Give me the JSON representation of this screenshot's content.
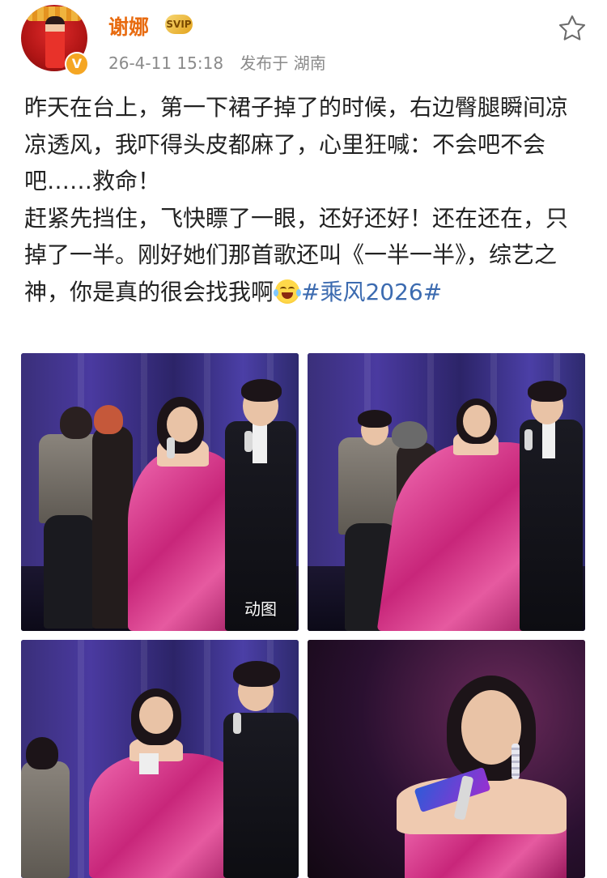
{
  "user": {
    "name": "谢娜",
    "vip_badge": "SVIP",
    "verified_icon": "verified-v-icon"
  },
  "meta": {
    "timestamp": "26-4-11 15:18",
    "location": "发布于 湖南"
  },
  "post": {
    "paragraph_1": "昨天在台上，第一下裙子掉了的时候，右边臀腿瞬间凉凉透风，我吓得头皮都麻了，心里狂喊：不会吧不会吧……救命！",
    "paragraph_2_text": "赶紧先挡住，飞快瞟了一眼，还好还好！还在还在，只掉了一半。刚好她们那首歌还叫《一半一半》，综艺之神，你是真的很会找我啊",
    "emoji": "laugh-cry-emoji",
    "hashtag": "#乘风2026#"
  },
  "images": {
    "gif_label": "动图"
  },
  "colors": {
    "username": "#e86b10",
    "hashtag": "#3c6bb0",
    "meta": "#8a8a8a"
  }
}
